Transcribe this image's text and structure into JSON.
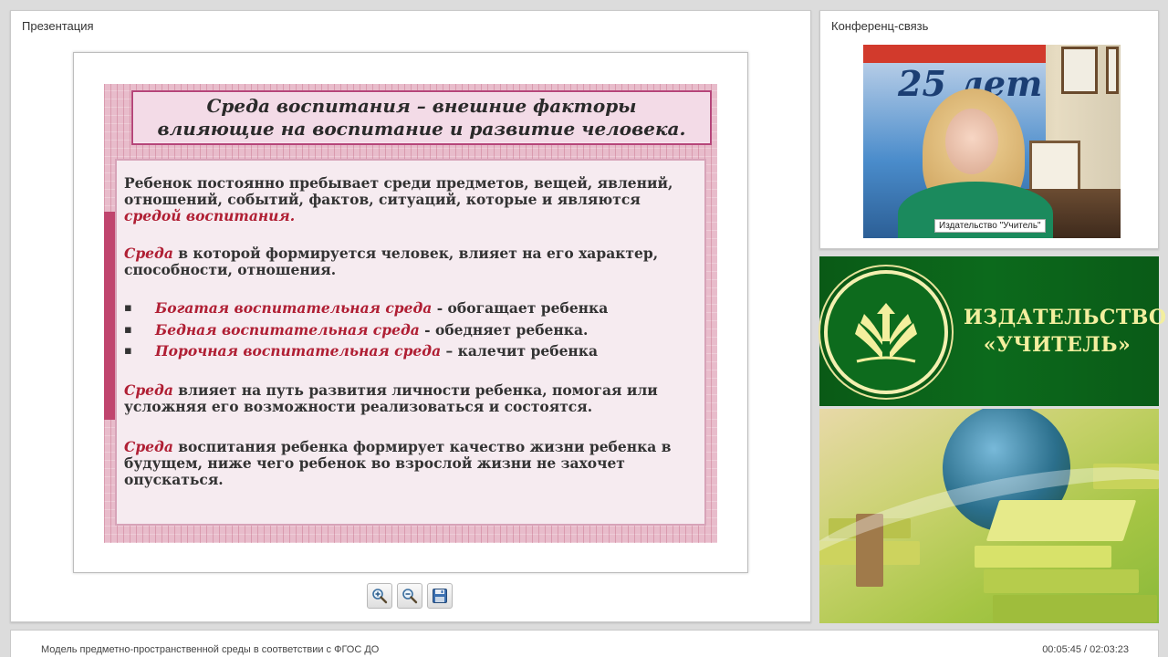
{
  "presentation": {
    "title": "Презентация",
    "slide": {
      "heading_line1": "Среда воспитания – внешние факторы",
      "heading_line2": "влияющие на воспитание и развитие человека.",
      "p1_text": "Ребенок  постоянно пребывает среди предметов, вещей, явлений, отношений, событий, фактов, ситуаций, которые и являются ",
      "p1_emphasis": "средой воспитания.",
      "p2_emphasis": "Среда",
      "p2_text": " в которой формируется человек, влияет на его характер, способности, отношения.",
      "bullets": [
        {
          "emphasis": "Богатая воспитательная среда",
          "text": " -  обогащает ребенка"
        },
        {
          "emphasis": "Бедная воспитательная среда",
          "text": " - обедняет ребенка."
        },
        {
          "emphasis": "Порочная воспитательная среда",
          "text": " – калечит ребенка"
        }
      ],
      "p4_emphasis": "Среда",
      "p4_text": " влияет на путь  развития личности ребенка, помогая или усложняя его возможности реализоваться и состоятся.",
      "p5_emphasis": "Среда",
      "p5_text": " воспитания ребенка формирует качество жизни ребенка в будущем, ниже чего ребенок во взрослой жизни не захочет опускаться."
    },
    "controls": {
      "zoom_in_icon": "zoom-in-icon",
      "zoom_out_icon": "zoom-out-icon",
      "save_icon": "floppy-disk-icon"
    }
  },
  "conference": {
    "title": "Конференц-связь",
    "video_caption": "Издательство \"Учитель\"",
    "banner_text": "25 лет"
  },
  "logo": {
    "line1": "ИЗДАТЕЛЬСТВО",
    "line2": "«УЧИТЕЛЬ»"
  },
  "footer": {
    "lecture_title": "Модель предметно-пространственной среды в соответствии с ФГОС ДО",
    "time": "00:05:45 / 02:03:23"
  },
  "colors": {
    "accent_red": "#b01f34",
    "logo_green": "#0c6a1c",
    "logo_text": "#f3ef9e"
  }
}
